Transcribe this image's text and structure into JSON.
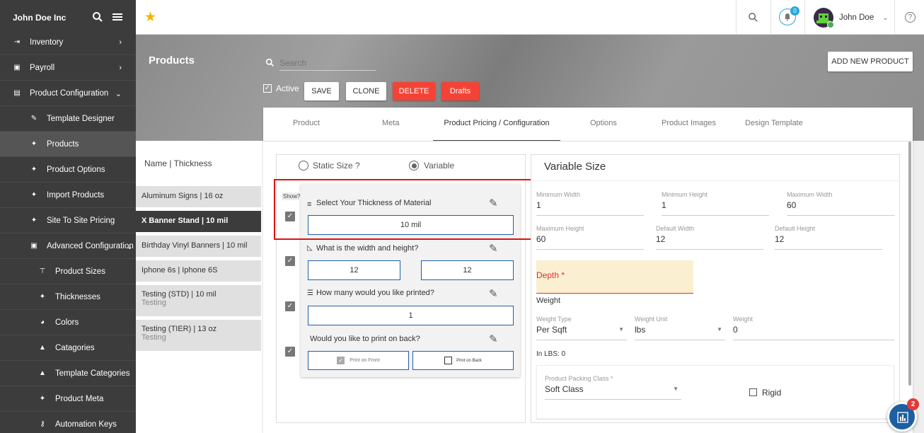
{
  "company": "John Doe Inc",
  "sidebar": {
    "items": [
      {
        "label": "Inventory",
        "icon": "login-icon",
        "level": 0,
        "arrow": "›"
      },
      {
        "label": "Payroll",
        "icon": "wallet-icon",
        "level": 0,
        "arrow": "›"
      },
      {
        "label": "Product Configuration",
        "icon": "store-icon",
        "level": 0,
        "arrow": "⌄"
      },
      {
        "label": "Template Designer",
        "icon": "pencil-icon",
        "level": 1
      },
      {
        "label": "Products",
        "icon": "wrench-icon",
        "level": 1,
        "active": true
      },
      {
        "label": "Product Options",
        "icon": "wrench-icon",
        "level": 1
      },
      {
        "label": "Import Products",
        "icon": "wrench-icon",
        "level": 1
      },
      {
        "label": "Site To Site Pricing",
        "icon": "wrench-icon",
        "level": 1
      },
      {
        "label": "Advanced Configuration",
        "icon": "box-icon",
        "level": 1,
        "arrow": "⌄"
      },
      {
        "label": "Product Sizes",
        "icon": "ruler-icon",
        "level": 2
      },
      {
        "label": "Thicknesses",
        "icon": "wrench-icon",
        "level": 2
      },
      {
        "label": "Colors",
        "icon": "palette-icon",
        "level": 2
      },
      {
        "label": "Catagories",
        "icon": "shapes-icon",
        "level": 2
      },
      {
        "label": "Template Categories",
        "icon": "shapes-icon",
        "level": 2
      },
      {
        "label": "Product Meta",
        "icon": "wrench-icon",
        "level": 2
      },
      {
        "label": "Automation Keys",
        "icon": "key-icon",
        "level": 2
      }
    ]
  },
  "topbar": {
    "notif_count": "0",
    "user_name": "John Doe"
  },
  "page": {
    "title": "Products",
    "search_placeholder": "Search",
    "active_label": "Active",
    "save": "SAVE",
    "clone": "CLONE",
    "delete": "DELETE",
    "drafts": "Drafts",
    "add_new": "ADD NEW PRODUCT"
  },
  "tabs": [
    "Product",
    "Meta",
    "Product Pricing / Configuration",
    "Options",
    "Product Images",
    "Design Template"
  ],
  "product_list": {
    "header": "Name | Thickness",
    "items": [
      {
        "name": "Aluminum Signs | 16 oz",
        "sub": ""
      },
      {
        "name": "X Banner Stand | 10 mil",
        "sub": "",
        "active": true
      },
      {
        "name": "Birthday Vinyl Banners | 10 mil",
        "sub": ""
      },
      {
        "name": "Iphone 6s | Iphone 6S",
        "sub": ""
      },
      {
        "name": "Testing (STD) | 10 mil",
        "sub": "Testing"
      },
      {
        "name": "Testing (TIER) | 13 oz",
        "sub": "Testing"
      }
    ]
  },
  "size_mode": {
    "static": "Static Size ?",
    "variable": "Variable"
  },
  "show_label": "Show?",
  "questions": {
    "thickness": {
      "label": "Select Your Thickness of Material",
      "value": "10 mil"
    },
    "dimensions": {
      "label": "What is the width and height?",
      "width": "12",
      "height": "12"
    },
    "quantity": {
      "label": "How many would you like printed?",
      "value": "1"
    },
    "back": {
      "label": "Would you like to print on back?",
      "front": "Print on Front",
      "backopt": "Print on Back"
    }
  },
  "variable_size": {
    "title": "Variable Size",
    "min_width_label": "Minimum Width",
    "min_width": "1",
    "min_height_label": "Minimum Height",
    "min_height": "1",
    "max_width_label": "Maximum Width",
    "max_width": "60",
    "max_height_label": "Maximum Height",
    "max_height": "60",
    "def_width_label": "Default Width",
    "def_width": "12",
    "def_height_label": "Default Height",
    "def_height": "12",
    "depth_label": "Depth *",
    "weight_heading": "Weight",
    "weight_type_label": "Weight Type",
    "weight_type": "Per Sqft",
    "weight_unit_label": "Weight Unit",
    "weight_unit": "lbs",
    "weight_label": "Weight",
    "weight": "0",
    "in_lbs": "In LBS: 0",
    "packing_label": "Product Packing Class *",
    "packing": "Soft Class",
    "rigid": "Rigid"
  },
  "fab_badge": "2",
  "colors": {
    "sidebar": "#3c3c3c",
    "red": "#f44336",
    "blue_border": "#1e5fa8",
    "highlight": "#dd1111"
  }
}
